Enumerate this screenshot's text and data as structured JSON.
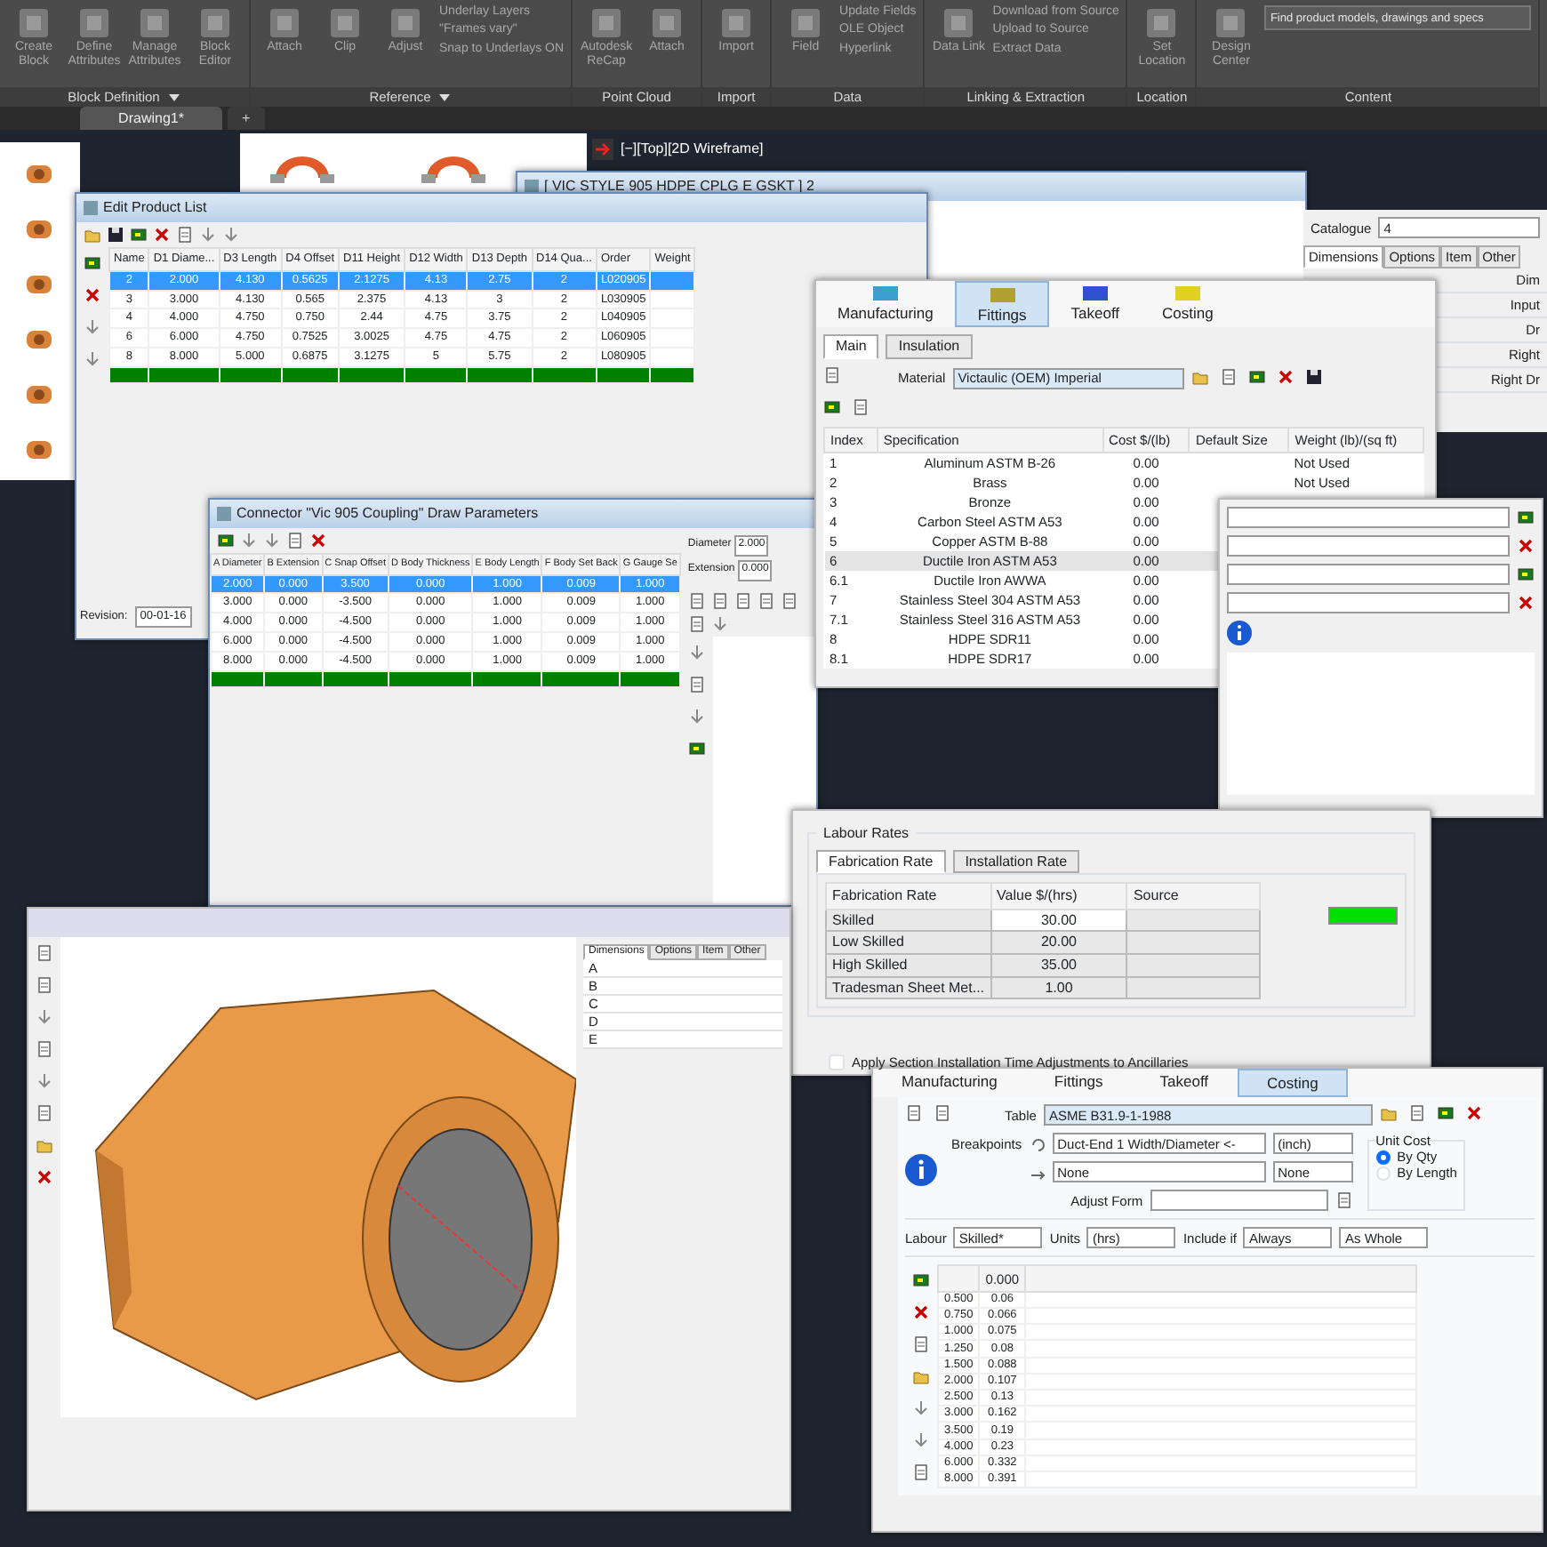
{
  "ribbon": {
    "groups": [
      {
        "label": "Block Definition",
        "caret": true,
        "buttons": [
          "Create Block",
          "Define Attributes",
          "Manage Attributes",
          "Block Editor"
        ]
      },
      {
        "label": "Reference",
        "caret": true,
        "buttons": [
          "Attach",
          "Clip",
          "Adjust"
        ],
        "small": [
          "Underlay Layers",
          "\"Frames vary\"",
          "Snap to Underlays ON"
        ]
      },
      {
        "label": "Point Cloud",
        "caret": false,
        "buttons": [
          "Autodesk ReCap",
          "Attach"
        ]
      },
      {
        "label": "Import",
        "caret": false,
        "buttons": [
          "Import"
        ]
      },
      {
        "label": "Data",
        "caret": false,
        "buttons": [
          "Field"
        ],
        "small": [
          "Update Fields",
          "OLE Object",
          "Hyperlink"
        ]
      },
      {
        "label": "Linking & Extraction",
        "caret": false,
        "buttons": [
          "Data Link"
        ],
        "small": [
          "Download from Source",
          "Upload to Source",
          "Extract Data"
        ]
      },
      {
        "label": "Location",
        "caret": false,
        "buttons": [
          "Set Location"
        ]
      },
      {
        "label": "Content",
        "caret": false,
        "buttons": [
          "Design Center"
        ],
        "search_placeholder": "Find product models, drawings and specs"
      }
    ]
  },
  "file_tabs": [
    {
      "label": "Drawing1*",
      "selected": true
    },
    {
      "label": "+",
      "selected": false
    }
  ],
  "viewport_label": "[−][Top][2D Wireframe]",
  "vic_window": {
    "title": "[ VIC STYLE 905 HDPE CPLG E GSKT ]  2"
  },
  "catalogue": {
    "label": "Catalogue",
    "value": "4",
    "tabs": [
      {
        "label": "Dimensions",
        "selected": true
      },
      {
        "label": "Options",
        "selected": false
      },
      {
        "label": "Item",
        "selected": false
      },
      {
        "label": "Other",
        "selected": false
      }
    ],
    "rows": [
      "Dim",
      "Input",
      "Dr",
      "Right",
      "Right Dr"
    ]
  },
  "product_list": {
    "title": "Edit Product List",
    "columns": [
      "Name",
      "D1 Diame...",
      "D3 Length",
      "D4 Offset",
      "D11 Height",
      "D12 Width",
      "D13 Depth",
      "D14 Qua...",
      "Order",
      "Weight"
    ],
    "rows": [
      {
        "cells": [
          "2",
          "2.000",
          "4.130",
          "0.5625",
          "2.1275",
          "4.13",
          "2.75",
          "2",
          "L020905"
        ],
        "selected": true
      },
      {
        "cells": [
          "3",
          "3.000",
          "4.130",
          "0.565",
          "2.375",
          "4.13",
          "3",
          "2",
          "L030905"
        ],
        "selected": false
      },
      {
        "cells": [
          "4",
          "4.000",
          "4.750",
          "0.750",
          "2.44",
          "4.75",
          "3.75",
          "2",
          "L040905"
        ],
        "selected": false
      },
      {
        "cells": [
          "6",
          "6.000",
          "4.750",
          "0.7525",
          "3.0025",
          "4.75",
          "4.75",
          "2",
          "L060905"
        ],
        "selected": false
      },
      {
        "cells": [
          "8",
          "8.000",
          "5.000",
          "0.6875",
          "3.1275",
          "5",
          "5.75",
          "2",
          "L080905"
        ],
        "selected": false
      }
    ],
    "revision_label": "Revision:",
    "revision": "00-01-16"
  },
  "connector": {
    "title": "Connector \"Vic 905 Coupling\" Draw Parameters",
    "columns": [
      "A Diameter",
      "B Extension",
      "C Snap Offset",
      "D Body Thickness",
      "E Body Length",
      "F Body Set Back",
      "G Gauge Se"
    ],
    "rows": [
      {
        "cells": [
          "2.000",
          "0.000",
          "3.500",
          "0.000",
          "1.000",
          "0.009",
          "1.000"
        ],
        "selected": true
      },
      {
        "cells": [
          "3.000",
          "0.000",
          "-3.500",
          "0.000",
          "1.000",
          "0.009",
          "1.000"
        ],
        "selected": false
      },
      {
        "cells": [
          "4.000",
          "0.000",
          "-4.500",
          "0.000",
          "1.000",
          "0.009",
          "1.000"
        ],
        "selected": false
      },
      {
        "cells": [
          "6.000",
          "0.000",
          "-4.500",
          "0.000",
          "1.000",
          "0.009",
          "1.000"
        ],
        "selected": false
      },
      {
        "cells": [
          "8.000",
          "0.000",
          "-4.500",
          "0.000",
          "1.000",
          "0.009",
          "1.000"
        ],
        "selected": false
      }
    ],
    "fields": [
      {
        "label": "Diameter",
        "value": "2.000"
      },
      {
        "label": "Extension",
        "value": "0.000"
      }
    ]
  },
  "fittings": {
    "tabs": [
      {
        "label": "Manufacturing",
        "selected": false
      },
      {
        "label": "Fittings",
        "selected": true
      },
      {
        "label": "Takeoff",
        "selected": false
      },
      {
        "label": "Costing",
        "selected": false
      }
    ],
    "subtabs": [
      {
        "label": "Main",
        "selected": true
      },
      {
        "label": "Insulation",
        "selected": false
      }
    ],
    "material_label": "Material",
    "material": "Victaulic (OEM) Imperial",
    "columns": [
      "Index",
      "Specification",
      "Cost $/(lb)",
      "Default Size",
      "Weight (lb)/(sq ft)"
    ],
    "rows": [
      {
        "index": "1",
        "specification": "Aluminum ASTM B-26",
        "cost": "0.00",
        "weight": "Not Used",
        "selected": false
      },
      {
        "index": "2",
        "specification": "Brass",
        "cost": "0.00",
        "weight": "Not Used",
        "selected": false
      },
      {
        "index": "3",
        "specification": "Bronze",
        "cost": "0.00",
        "selected": false
      },
      {
        "index": "4",
        "specification": "Carbon Steel ASTM A53",
        "cost": "0.00",
        "selected": false
      },
      {
        "index": "5",
        "specification": "Copper ASTM B-88",
        "cost": "0.00",
        "selected": false
      },
      {
        "index": "6",
        "specification": "Ductile Iron ASTM A53",
        "cost": "0.00",
        "selected": true
      },
      {
        "index": "6.1",
        "specification": "Ductile Iron AWWA",
        "cost": "0.00",
        "selected": false
      },
      {
        "index": "7",
        "specification": "Stainless Steel 304 ASTM A53",
        "cost": "0.00",
        "selected": false
      },
      {
        "index": "7.1",
        "specification": "Stainless Steel 316 ASTM A53",
        "cost": "0.00",
        "selected": false
      },
      {
        "index": "8",
        "specification": "HDPE SDR11",
        "cost": "0.00",
        "selected": false
      },
      {
        "index": "8.1",
        "specification": "HDPE SDR17",
        "cost": "0.00",
        "selected": false
      }
    ]
  },
  "labour": {
    "title": "Labour Rates",
    "tabs": [
      {
        "label": "Fabrication Rate",
        "selected": true
      },
      {
        "label": "Installation Rate",
        "selected": false
      }
    ],
    "columns": [
      "Fabrication Rate",
      "Value $/(hrs)",
      "Source"
    ],
    "rows": [
      {
        "name": "Skilled",
        "value": "30.00",
        "selected": true
      },
      {
        "name": "Low Skilled",
        "value": "20.00",
        "selected": false
      },
      {
        "name": "High Skilled",
        "value": "35.00",
        "selected": false
      },
      {
        "name": "Tradesman Sheet Met...",
        "value": "1.00",
        "selected": false
      }
    ],
    "apply": {
      "label": "Apply Section Installation Time Adjustments to Ancillaries",
      "checked": false
    }
  },
  "model_window": {
    "tabs": [
      {
        "label": "Dimensions",
        "selected": true
      },
      {
        "label": "Options",
        "selected": false
      },
      {
        "label": "Item",
        "selected": false
      },
      {
        "label": "Other",
        "selected": false
      }
    ],
    "rows": [
      "A",
      "B",
      "C",
      "D",
      "E"
    ]
  },
  "costing": {
    "tabs": [
      {
        "label": "Manufacturing",
        "selected": false
      },
      {
        "label": "Fittings",
        "selected": false
      },
      {
        "label": "Takeoff",
        "selected": false
      },
      {
        "label": "Costing",
        "selected": true
      }
    ],
    "table_label": "Table",
    "table": "ASME B31.9-1-1988",
    "breakpoints_label": "Breakpoints",
    "bp1": "Duct-End 1 Width/Diameter <-",
    "bp1_unit": "(inch)",
    "bp2": "None",
    "bp2_unit": "None",
    "adjust_label": "Adjust Form",
    "unit_cost": {
      "label": "Unit Cost",
      "options": [
        {
          "label": "By Qty",
          "selected": true
        },
        {
          "label": "By Length",
          "selected": false
        }
      ]
    },
    "filters": [
      {
        "label": "Labour",
        "value": "Skilled*"
      },
      {
        "label": "Units",
        "value": "(hrs)"
      },
      {
        "label": "Include if",
        "value": "Always"
      },
      {
        "value": "As Whole"
      }
    ],
    "header": "0.000",
    "rows": [
      {
        "size": "0.500",
        "value": "0.06"
      },
      {
        "size": "0.750",
        "value": "0.066"
      },
      {
        "size": "1.000",
        "value": "0.075"
      },
      {
        "size": "1.250",
        "value": "0.08"
      },
      {
        "size": "1.500",
        "value": "0.088"
      },
      {
        "size": "2.000",
        "value": "0.107"
      },
      {
        "size": "2.500",
        "value": "0.13"
      },
      {
        "size": "3.000",
        "value": "0.162"
      },
      {
        "size": "3.500",
        "value": "0.19"
      },
      {
        "size": "4.000",
        "value": "0.23"
      },
      {
        "size": "6.000",
        "value": "0.332"
      },
      {
        "size": "8.000",
        "value": "0.391"
      }
    ]
  }
}
